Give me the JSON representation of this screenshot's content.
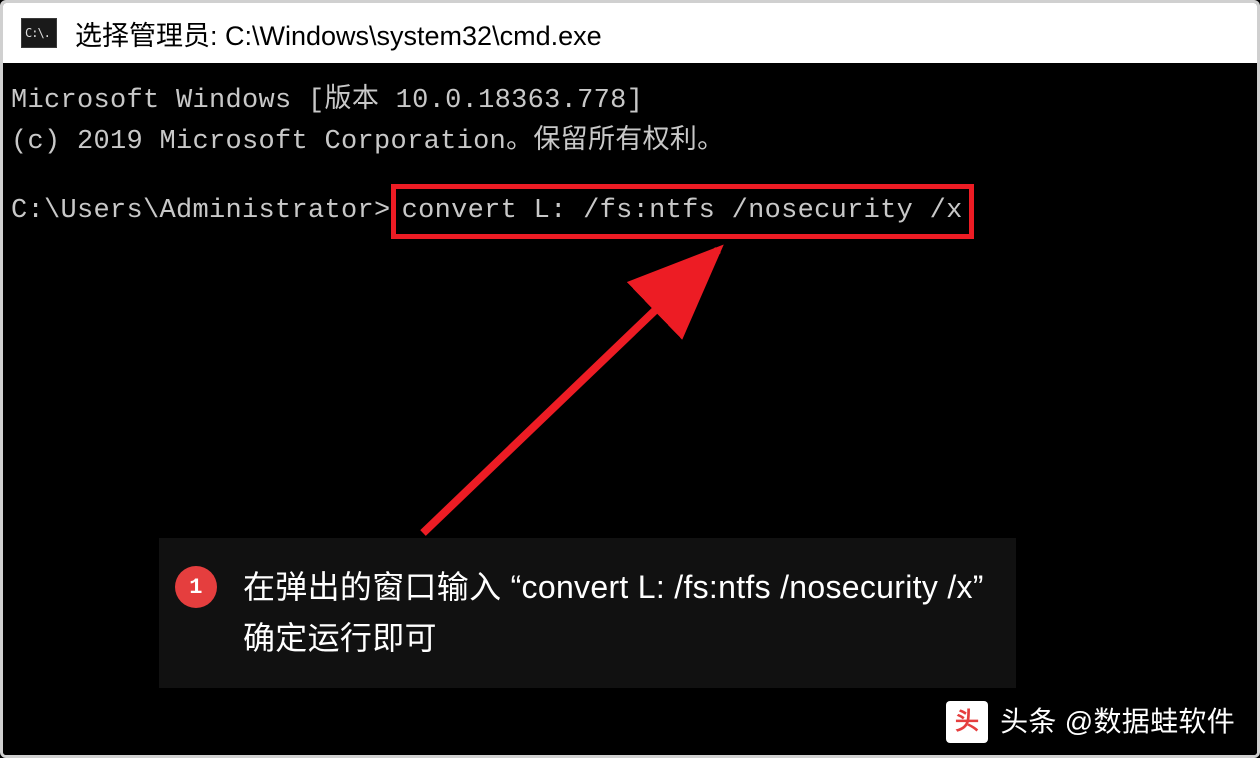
{
  "window": {
    "icon_label": "C:\\.",
    "title": "选择管理员: C:\\Windows\\system32\\cmd.exe"
  },
  "terminal": {
    "line1": "Microsoft Windows [版本 10.0.18363.778]",
    "line2": "(c) 2019 Microsoft Corporation。保留所有权利。",
    "prompt": "C:\\Users\\Administrator>",
    "command": "convert L: /fs:ntfs /nosecurity /x"
  },
  "annotation": {
    "badge": "1",
    "text_line1": "在弹出的窗口输入 “convert L: /fs:ntfs /nosecurity /x”",
    "text_line2": "确定运行即可"
  },
  "watermark": {
    "logo": "头",
    "text": "头条 @数据蛙软件"
  }
}
